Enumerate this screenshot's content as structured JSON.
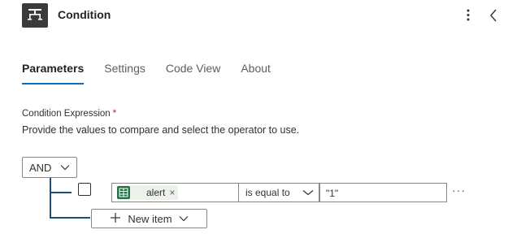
{
  "header": {
    "title": "Condition",
    "app_icon": "condition-icon",
    "more_icon": "more-vertical-icon",
    "collapse_icon": "chevron-left-icon"
  },
  "tabs": [
    {
      "label": "Parameters",
      "active": true
    },
    {
      "label": "Settings",
      "active": false
    },
    {
      "label": "Code View",
      "active": false
    },
    {
      "label": "About",
      "active": false
    }
  ],
  "condition": {
    "label": "Condition Expression",
    "required_marker": "*",
    "description": "Provide the values to compare and select the operator to use.",
    "group_operator": "AND",
    "rows": [
      {
        "operand_token": "alert",
        "token_icon": "excel-icon",
        "token_remove": "×",
        "operator": "is equal to",
        "value": "\"1\"",
        "more": "···"
      }
    ],
    "new_item_label": "New item"
  },
  "colors": {
    "accent": "#0f6cbd",
    "connector": "#1f4e79",
    "token_icon_bg": "#217346",
    "required": "#a4262c"
  }
}
